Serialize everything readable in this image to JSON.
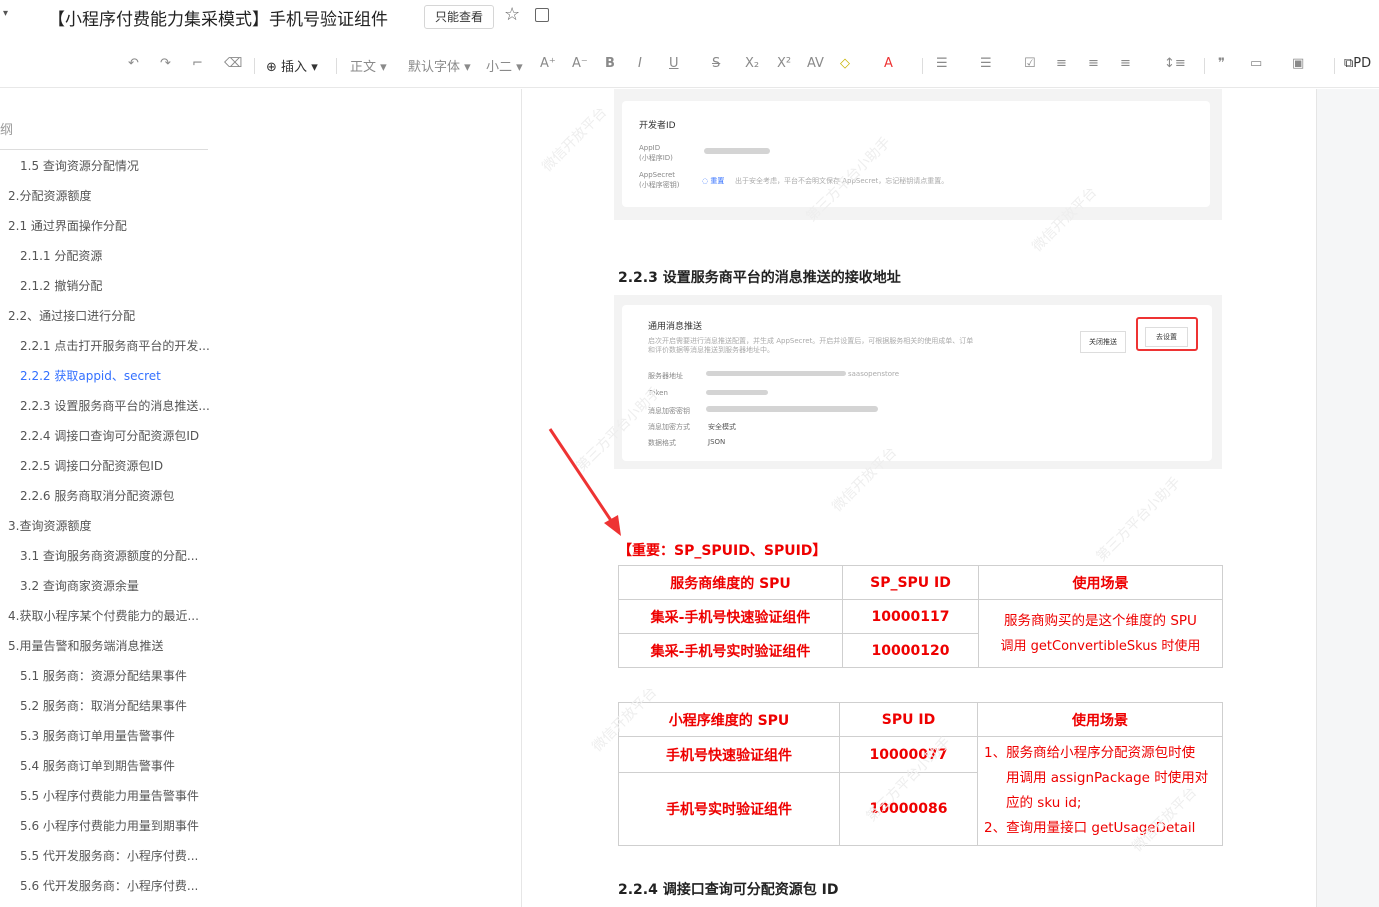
{
  "window": {
    "doc_title": "【小程序付费能力集采模式】手机号验证组件",
    "readonly_label": "只能查看"
  },
  "toolbar": {
    "insert_label": "插入",
    "style_label": "正文",
    "font_label": "默认字体",
    "size_label": "小二",
    "pdf_label": "PD"
  },
  "sidebar": {
    "outline_label": "纲",
    "items": [
      {
        "label": "1.5  查询资源分配情况",
        "level": 2
      },
      {
        "label": "2.分配资源额度",
        "level": 1
      },
      {
        "label": "2.1  通过界面操作分配",
        "level": 1
      },
      {
        "label": "2.1.1  分配资源",
        "level": 2
      },
      {
        "label": "2.1.2  撤销分配",
        "level": 2
      },
      {
        "label": "2.2、通过接口进行分配",
        "level": 1
      },
      {
        "label": "2.2.1  点击打开服务商平台的开发...",
        "level": 2
      },
      {
        "label": "2.2.2  获取appid、secret",
        "level": 2,
        "active": true
      },
      {
        "label": "2.2.3  设置服务商平台的消息推送...",
        "level": 2
      },
      {
        "label": "2.2.4  调接口查询可分配资源包ID",
        "level": 2
      },
      {
        "label": "2.2.5  调接口分配资源包ID",
        "level": 2
      },
      {
        "label": "2.2.6  服务商取消分配资源包",
        "level": 2
      },
      {
        "label": "3.查询资源额度",
        "level": 1
      },
      {
        "label": "3.1  查询服务商资源额度的分配...",
        "level": 2
      },
      {
        "label": "3.2  查询商家资源余量",
        "level": 2
      },
      {
        "label": "4.获取小程序某个付费能力的最近...",
        "level": 1
      },
      {
        "label": "5.用量告警和服务端消息推送",
        "level": 1
      },
      {
        "label": "5.1  服务商：资源分配结果事件",
        "level": 2
      },
      {
        "label": "5.2  服务商：取消分配结果事件",
        "level": 2
      },
      {
        "label": "5.3  服务商订单用量告警事件",
        "level": 2
      },
      {
        "label": "5.4  服务商订单到期告警事件",
        "level": 2
      },
      {
        "label": "5.5  小程序付费能力用量告警事件",
        "level": 2
      },
      {
        "label": "5.6  小程序付费能力用量到期事件",
        "level": 2
      },
      {
        "label": "5.5  代开发服务商：小程序付费...",
        "level": 2
      },
      {
        "label": "5.6  代开发服务商：小程序付费...",
        "level": 2
      }
    ]
  },
  "doc": {
    "dev_id_card": {
      "title": "开发者ID",
      "appid_label": "AppID",
      "appid_sub": "(小程序ID)",
      "secret_label": "AppSecret",
      "secret_sub": "(小程序密钥)",
      "reset_label": "重置",
      "secret_note": "出于安全考虑，平台不会明文保存 AppSecret，忘记秘钥请点重置。"
    },
    "heading_223": "2.2.3 设置服务商平台的消息推送的接收地址",
    "push_card": {
      "title": "通用消息推送",
      "desc1": "启次开启需要进行消息推送配置，并生成 AppSecret。开启并设置后，可根据服务相关的使用成单、订单",
      "desc2": "和评价数据等消息推送到服务器地址中。",
      "close_label": "关闭推送",
      "setup_label": "去设置",
      "rows": [
        "服务器地址",
        "Token",
        "消息加密密钥",
        "消息加密方式",
        "数据格式"
      ],
      "server_url_visible": "saasopenstore",
      "mode_value": "安全模式",
      "format_value": "JSON"
    },
    "important_label": "【重要：SP_SPUID、SPUID】",
    "table1": {
      "headers": [
        "服务商维度的 SPU",
        "SP_SPU ID",
        "使用场景"
      ],
      "rows": [
        {
          "name": "集采-手机号快速验证组件",
          "id": "10000117"
        },
        {
          "name": "集采-手机号实时验证组件",
          "id": "10000120"
        }
      ],
      "scene_line1": "服务商购买的是这个维度的 SPU",
      "scene_line2": "调用 getConvertibleSkus 时使用"
    },
    "table2": {
      "headers": [
        "小程序维度的 SPU",
        "SPU ID",
        "使用场景"
      ],
      "rows": [
        {
          "name": "手机号快速验证组件",
          "id": "10000077"
        },
        {
          "name": "手机号实时验证组件",
          "id": "10000086"
        }
      ],
      "scene_line1": "1、服务商给小程序分配资源包时使",
      "scene_line2": "用调用 assignPackage 时使用对",
      "scene_line3": "应的  sku id;",
      "scene_line4": "2、查询用量接口 getUsageDetail"
    },
    "heading_224": "2.2.4 调接口查询可分配资源包 ID",
    "watermarks": [
      "第三方平台小助手",
      "微信开放平台"
    ]
  }
}
